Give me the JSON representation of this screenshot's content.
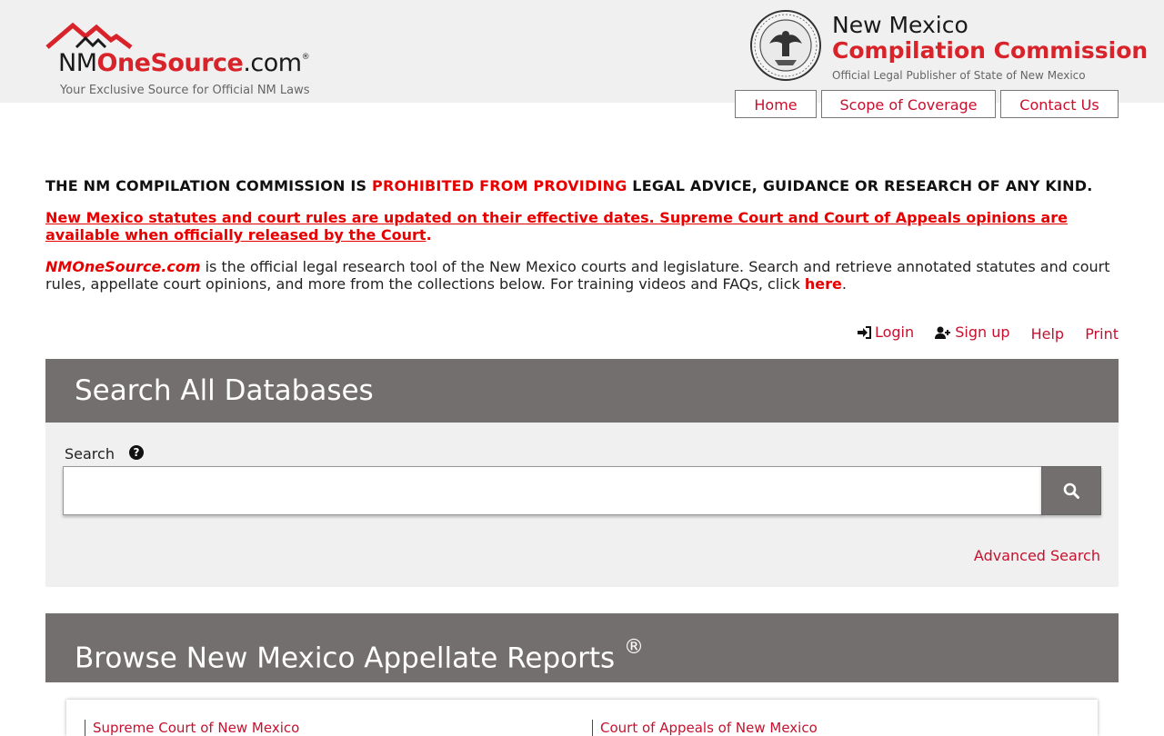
{
  "header": {
    "logo": {
      "brand_nm": "NM",
      "brand_one": "OneSource",
      "brand_com": ".com",
      "brand_reg": "®",
      "tagline": "Your Exclusive Source for Official NM Laws",
      "icon": "mountains-logo-icon"
    },
    "seal": {
      "icon": "state-seal-icon"
    },
    "commission": {
      "line1": "New Mexico",
      "line2": "Compilation Commission",
      "line3": "Official Legal Publisher of State of New Mexico"
    },
    "nav": [
      {
        "label": "Home"
      },
      {
        "label": "Scope of Coverage"
      },
      {
        "label": "Contact Us"
      }
    ]
  },
  "notices": {
    "prohibited_a": "THE NM COMPILATION COMMISSION IS ",
    "prohibited_b": "PROHIBITED FROM PROVIDING",
    "prohibited_c": " LEGAL ADVICE, GUIDANCE OR RESEARCH OF ANY KIND.",
    "updates": "New Mexico statutes and court rules are updated on their effective dates.  Supreme Court and Court of Appeals opinions are available when officially released by the Court",
    "updates_end": "."
  },
  "intro": {
    "brand": "NMOneSource.com",
    "text": " is the official legal research tool of the New Mexico courts and legislature.  Search and retrieve annotated statutes and court rules, appellate court opinions, and more from the collections below.  For training videos and FAQs, click ",
    "here": "here",
    "end": "."
  },
  "utility_links": {
    "login": "Login",
    "signup": "Sign up",
    "help": "Help",
    "print": "Print"
  },
  "search_panel": {
    "title": "Search All Databases",
    "label": "Search",
    "help_glyph": "?",
    "input_value": "",
    "advanced": "Advanced Search"
  },
  "reports_panel": {
    "title": "Browse New Mexico Appellate Reports",
    "reg": "®",
    "links": [
      "Supreme Court of New Mexico",
      "Court of Appeals of New Mexico"
    ]
  },
  "colors": {
    "brand_red": "#d8232a",
    "link_red": "#c8102e",
    "panel_gray": "#736f6e",
    "band_gray": "#f0f0f0"
  }
}
